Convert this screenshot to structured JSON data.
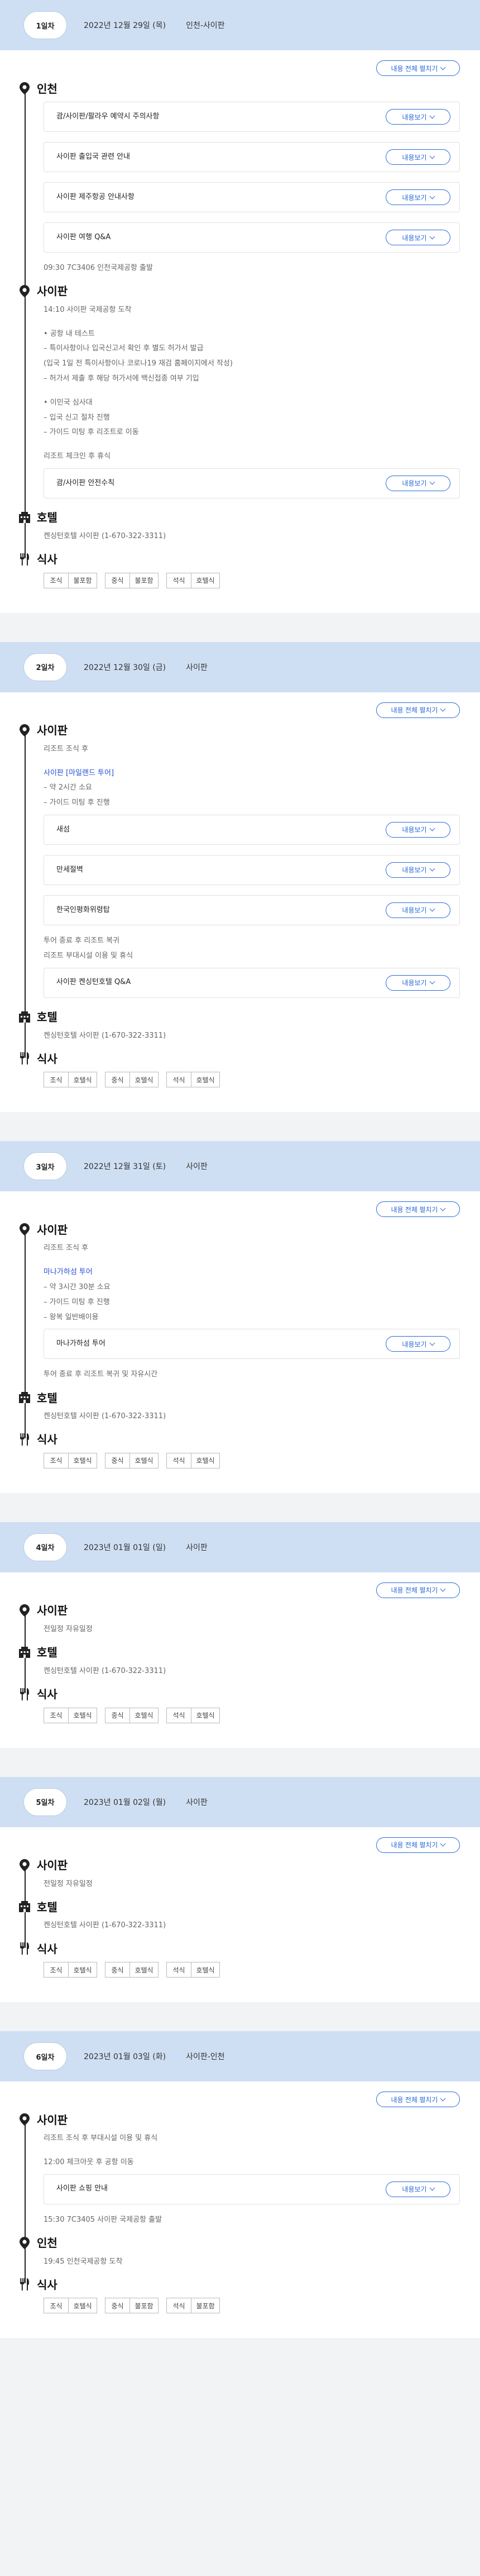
{
  "ui": {
    "expand_all": "내용 전체 펼치기",
    "see_more": "내용보기"
  },
  "days": [
    {
      "badge": "1일차",
      "date": "2022년 12월 29일 (목)",
      "route": "인천-사이판",
      "sections": [
        {
          "kind": "location",
          "title": "인천",
          "lines": [],
          "cards": [
            "괌/사이판/팔라우 예약시 주의사항",
            "사이판 출입국 관련 안내",
            "사이판 제주항공 안내사항",
            "사이판 여행 Q&A"
          ],
          "after": [
            "09:30 7C3406 인천국제공항 출발"
          ]
        },
        {
          "kind": "location",
          "title": "사이판",
          "lines": [
            "14:10 사이판 국제공항 도착",
            "",
            "• 공항 내 테스트",
            "– 특이사항이나 입국신고서 확인 후 별도 허가서 발급",
            "(입국 1일 전 특이사항이나 코로나19 재검 홈페이지에서 작성)",
            "– 허가서 제출 후 해당 허가서에 백신접종 여부 기입",
            "",
            "• 이민국 심사대",
            "– 입국 신고 절차 진행",
            "– 가이드 미팅 후 리조트로 이동",
            "",
            "리조트 체크인 후 휴식"
          ],
          "cards": [
            "괌/사이판 안전수칙"
          ],
          "after": []
        },
        {
          "kind": "hotel",
          "title": "호텔",
          "lines": [
            "켄싱턴호텔 사이판 (1-670-322-3311)"
          ],
          "cards": [],
          "after": []
        },
        {
          "kind": "meal",
          "title": "식사",
          "meals": [
            {
              "k": "조식",
              "v": "불포함"
            },
            {
              "k": "중식",
              "v": "불포함"
            },
            {
              "k": "석식",
              "v": "호텔식"
            }
          ]
        }
      ]
    },
    {
      "badge": "2일차",
      "date": "2022년 12월 30일 (금)",
      "route": "사이판",
      "sections": [
        {
          "kind": "location",
          "title": "사이판",
          "lines": [
            "리조트 조식 후",
            "",
            "사이판 [마일랜드 투어]",
            "– 약 2시간 소요",
            "– 가이드 미팅 후 진행"
          ],
          "highlight": "사이판 마일랜드 투어",
          "cards": [
            "새섬",
            "만세절벽",
            "한국인평화위령탑"
          ],
          "after": [
            "투어 종료 후 리조트 복귀",
            "리조트 부대시설 이용 및 휴식"
          ],
          "cards2": [
            "사이판 켄싱턴호텔 Q&A"
          ]
        },
        {
          "kind": "hotel",
          "title": "호텔",
          "lines": [
            "켄싱턴호텔 사이판 (1-670-322-3311)"
          ],
          "cards": [],
          "after": []
        },
        {
          "kind": "meal",
          "title": "식사",
          "meals": [
            {
              "k": "조식",
              "v": "호텔식"
            },
            {
              "k": "중식",
              "v": "호텔식"
            },
            {
              "k": "석식",
              "v": "호텔식"
            }
          ]
        }
      ]
    },
    {
      "badge": "3일차",
      "date": "2022년 12월 31일 (토)",
      "route": "사이판",
      "sections": [
        {
          "kind": "location",
          "title": "사이판",
          "lines": [
            "리조트 조식 후",
            "",
            "마나가하섬 투어",
            "– 약 3시간 30분 소요",
            "– 가이드 미팅 후 진행",
            "– 왕복 일반배이용"
          ],
          "highlight": "마나가하섬 투어",
          "cards": [
            "마나가하섬 투어"
          ],
          "after": [
            "투어 종료 후 리조트 복귀 및 자유시간"
          ]
        },
        {
          "kind": "hotel",
          "title": "호텔",
          "lines": [
            "켄싱턴호텔 사이판 (1-670-322-3311)"
          ],
          "cards": [],
          "after": []
        },
        {
          "kind": "meal",
          "title": "식사",
          "meals": [
            {
              "k": "조식",
              "v": "호텔식"
            },
            {
              "k": "중식",
              "v": "호텔식"
            },
            {
              "k": "석식",
              "v": "호텔식"
            }
          ]
        }
      ]
    },
    {
      "badge": "4일차",
      "date": "2023년 01월 01일 (일)",
      "route": "사이판",
      "sections": [
        {
          "kind": "location",
          "title": "사이판",
          "lines": [
            "전일정 자유일정"
          ],
          "cards": [],
          "after": []
        },
        {
          "kind": "hotel",
          "title": "호텔",
          "lines": [
            "켄싱턴호텔 사이판 (1-670-322-3311)"
          ],
          "cards": [],
          "after": []
        },
        {
          "kind": "meal",
          "title": "식사",
          "meals": [
            {
              "k": "조식",
              "v": "호텔식"
            },
            {
              "k": "중식",
              "v": "호텔식"
            },
            {
              "k": "석식",
              "v": "호텔식"
            }
          ]
        }
      ]
    },
    {
      "badge": "5일차",
      "date": "2023년 01월 02일 (월)",
      "route": "사이판",
      "sections": [
        {
          "kind": "location",
          "title": "사이판",
          "lines": [
            "전일정 자유일정"
          ],
          "cards": [],
          "after": []
        },
        {
          "kind": "hotel",
          "title": "호텔",
          "lines": [
            "켄싱턴호텔 사이판 (1-670-322-3311)"
          ],
          "cards": [],
          "after": []
        },
        {
          "kind": "meal",
          "title": "식사",
          "meals": [
            {
              "k": "조식",
              "v": "호텔식"
            },
            {
              "k": "중식",
              "v": "호텔식"
            },
            {
              "k": "석식",
              "v": "호텔식"
            }
          ]
        }
      ]
    },
    {
      "badge": "6일차",
      "date": "2023년 01월 03일 (화)",
      "route": "사이판-인천",
      "sections": [
        {
          "kind": "location",
          "title": "사이판",
          "lines": [
            "리조트 조식 후 부대시설 이용 및 휴식",
            "",
            "12:00 체크아웃 후 공항 이동"
          ],
          "cards": [
            "사이판 쇼핑 안내"
          ],
          "after": [
            "15:30 7C3405 사이판 국제공항 출발"
          ]
        },
        {
          "kind": "location",
          "title": "인천",
          "lines": [
            "19:45 인천국제공항 도착"
          ],
          "cards": [],
          "after": []
        },
        {
          "kind": "meal",
          "title": "식사",
          "meals": [
            {
              "k": "조식",
              "v": "호텔식"
            },
            {
              "k": "중식",
              "v": "불포함"
            },
            {
              "k": "석식",
              "v": "불포함"
            }
          ]
        }
      ]
    }
  ]
}
